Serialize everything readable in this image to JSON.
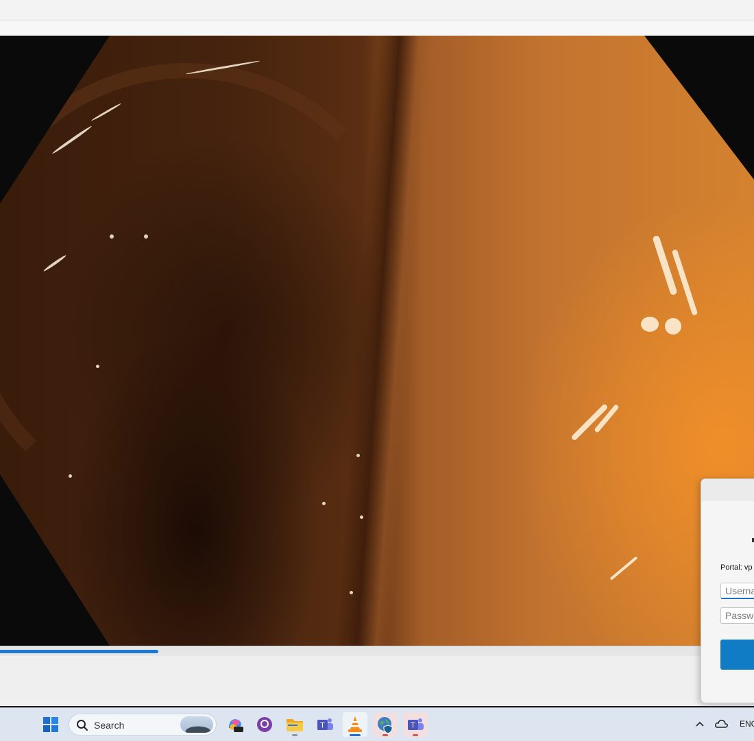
{
  "video": {
    "progress_fraction": 0.21
  },
  "vpn_dialog": {
    "portal_text": "Portal: vp",
    "username_placeholder": "Userna",
    "password_placeholder": "Passwo",
    "accent_color": "#0f7cc5"
  },
  "taskbar": {
    "search_placeholder": "Search",
    "apps": [
      {
        "name": "start-button",
        "icon": "windows-icon"
      },
      {
        "name": "copilot",
        "icon": "copilot-pre-icon",
        "badge": "PRE"
      },
      {
        "name": "github-desktop",
        "icon": "github-icon"
      },
      {
        "name": "file-explorer",
        "icon": "folder-icon"
      },
      {
        "name": "teams-classic",
        "icon": "teams-icon"
      },
      {
        "name": "vlc",
        "icon": "vlc-cone-icon"
      },
      {
        "name": "browser-vpn",
        "icon": "globe-shield-icon"
      },
      {
        "name": "teams",
        "icon": "teams-icon"
      }
    ],
    "tray": {
      "language": "ENG"
    }
  }
}
